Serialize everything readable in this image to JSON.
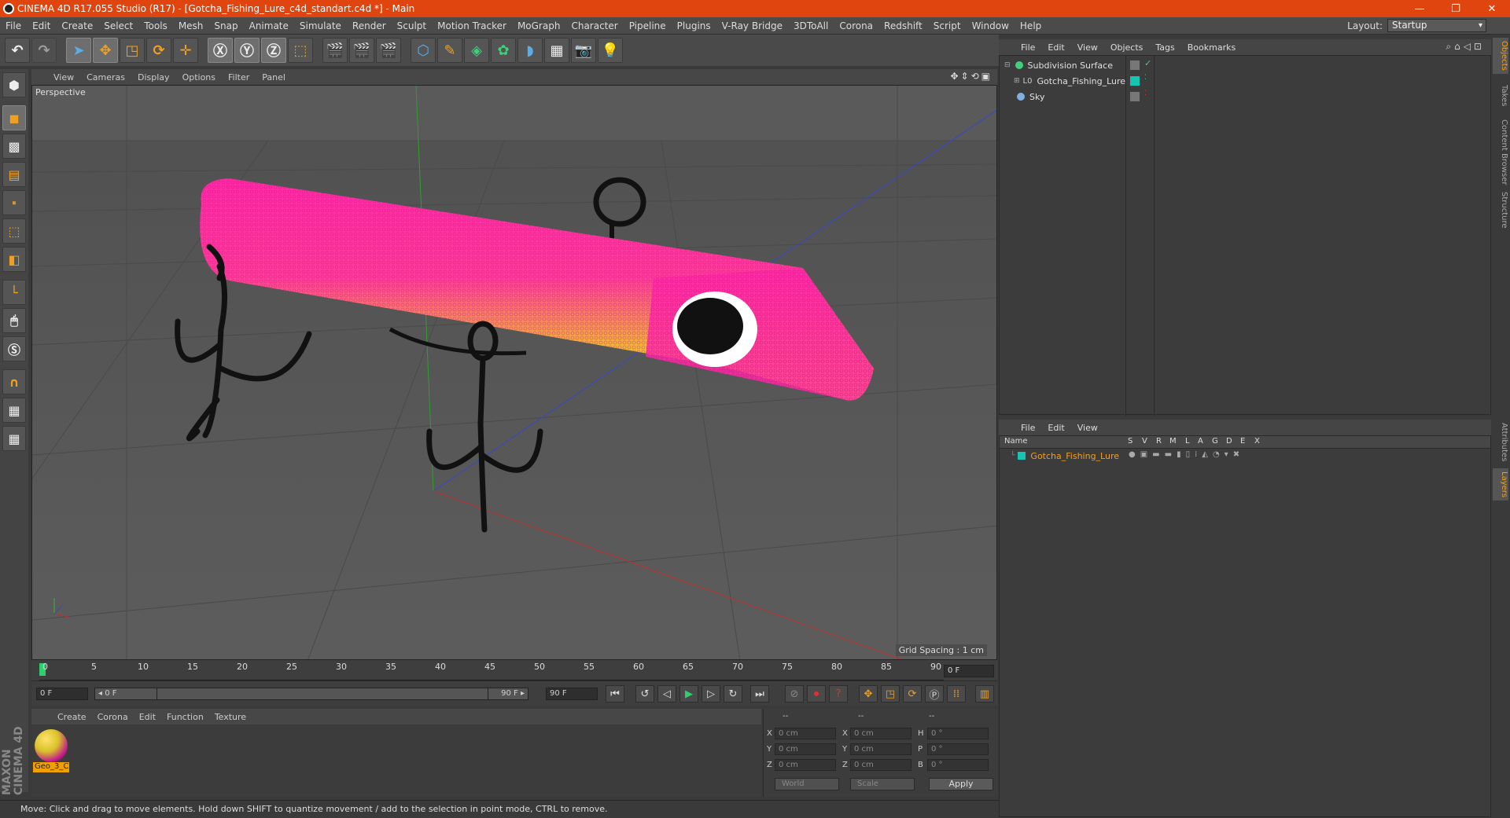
{
  "window": {
    "title": "CINEMA 4D R17.055 Studio (R17) - [Gotcha_Fishing_Lure_c4d_standart.c4d *] - Main",
    "min": "—",
    "restore": "❐",
    "close": "✕"
  },
  "menubar": {
    "items": [
      "File",
      "Edit",
      "Create",
      "Select",
      "Tools",
      "Mesh",
      "Snap",
      "Animate",
      "Simulate",
      "Render",
      "Sculpt",
      "Motion Tracker",
      "MoGraph",
      "Character",
      "Pipeline",
      "Plugins",
      "V-Ray Bridge",
      "3DToAll",
      "Corona",
      "Redshift",
      "Script",
      "Window",
      "Help"
    ],
    "layout_label": "Layout:",
    "layout_value": "Startup"
  },
  "viewport": {
    "menu": [
      "View",
      "Cameras",
      "Display",
      "Options",
      "Filter",
      "Panel"
    ],
    "label": "Perspective",
    "grid_spacing": "Grid Spacing : 1 cm"
  },
  "timeline": {
    "ticks": [
      "0",
      "5",
      "10",
      "15",
      "20",
      "25",
      "30",
      "35",
      "40",
      "45",
      "50",
      "55",
      "60",
      "65",
      "70",
      "75",
      "80",
      "85",
      "90"
    ],
    "current_frame": "0 F",
    "start_field": "0 F",
    "range_start": "◂ 0 F",
    "range_end": "90 F ▸",
    "end_field": "90 F"
  },
  "material_manager": {
    "menu": [
      "Create",
      "Corona",
      "Edit",
      "Function",
      "Texture"
    ],
    "material_name": "Geo_3_C"
  },
  "coordinates": {
    "headers": [
      "--",
      "--",
      "--"
    ],
    "rows": [
      {
        "axis1": "X",
        "v1": "0 cm",
        "axis2": "X",
        "v2": "0 cm",
        "axis3": "H",
        "v3": "0 °"
      },
      {
        "axis1": "Y",
        "v1": "0 cm",
        "axis2": "Y",
        "v2": "0 cm",
        "axis3": "P",
        "v3": "0 °"
      },
      {
        "axis1": "Z",
        "v1": "0 cm",
        "axis2": "Z",
        "v2": "0 cm",
        "axis3": "B",
        "v3": "0 °"
      }
    ],
    "mode": "World",
    "scale": "Scale",
    "apply": "Apply"
  },
  "status": "Move: Click and drag to move elements. Hold down SHIFT to quantize movement / add to the selection in point mode, CTRL to remove.",
  "maxon": "MAXON CINEMA 4D",
  "object_manager": {
    "menu": [
      "File",
      "Edit",
      "View",
      "Objects",
      "Tags",
      "Bookmarks"
    ],
    "objects": [
      {
        "name": "Subdivision Surface",
        "level": 0
      },
      {
        "name": "Gotcha_Fishing_Lure",
        "level": 1
      },
      {
        "name": "Sky",
        "level": 0
      }
    ]
  },
  "layer_manager": {
    "menu": [
      "File",
      "Edit",
      "View"
    ],
    "columns": [
      "Name",
      "S",
      "V",
      "R",
      "M",
      "L",
      "A",
      "G",
      "D",
      "E",
      "X"
    ],
    "layers": [
      {
        "name": "Gotcha_Fishing_Lure",
        "color": "#17c3b2"
      }
    ]
  },
  "side_tabs": [
    "Objects",
    "Takes",
    "Content Browser",
    "Structure",
    "Attributes",
    "Layers"
  ],
  "colors": {
    "accent": "#f0a020",
    "titlebar": "#e0450f",
    "lure_pink": "#ff2aa6",
    "lure_yellow": "#d8ee1a"
  }
}
